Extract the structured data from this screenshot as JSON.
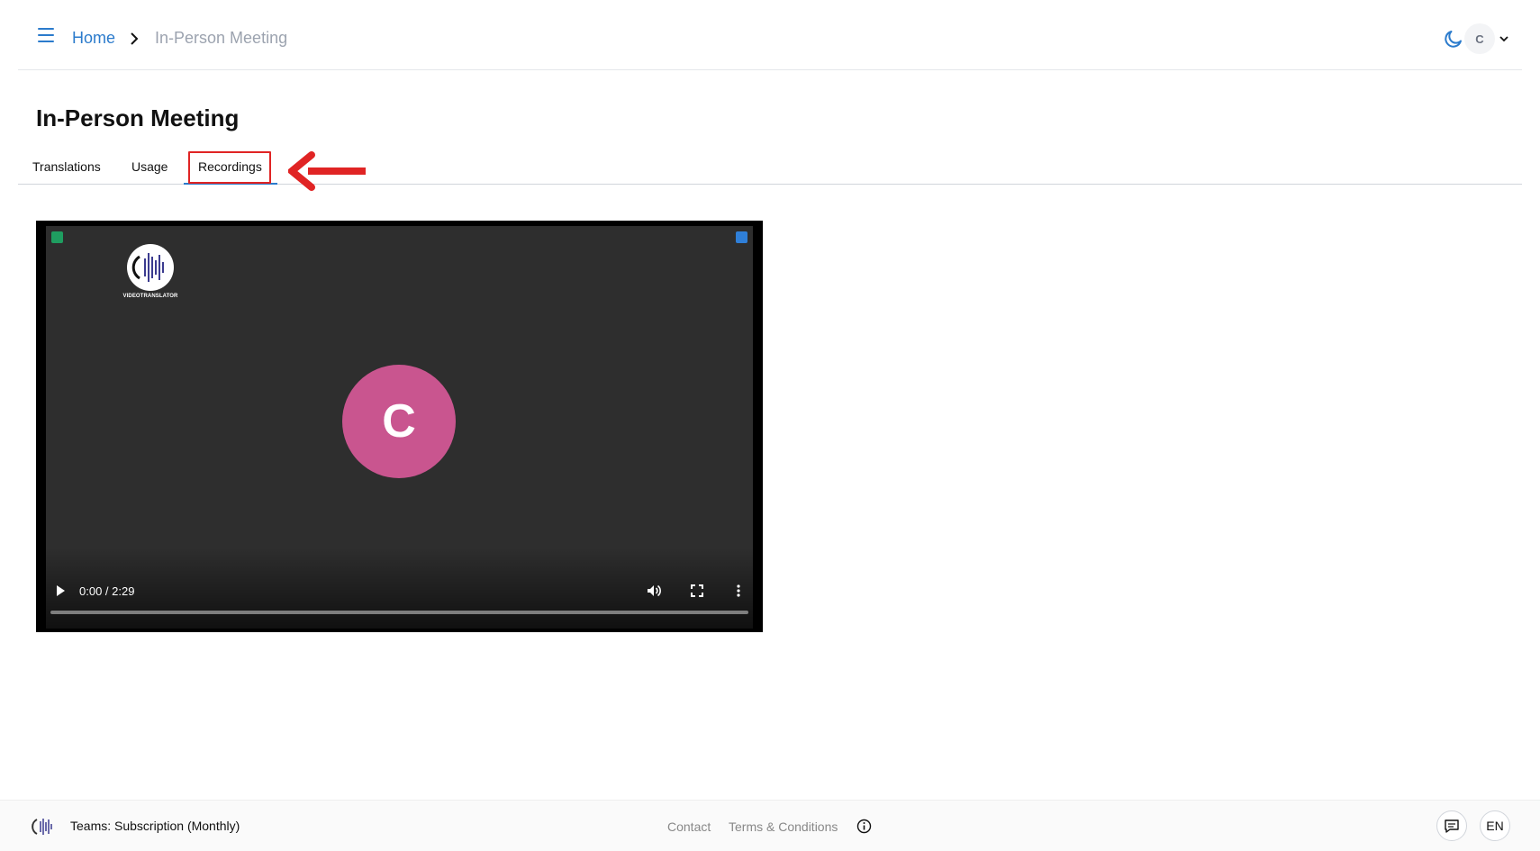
{
  "header": {
    "breadcrumb": {
      "home": "Home",
      "current": "In-Person Meeting"
    },
    "user_initial": "C",
    "icons": [
      "menu-icon",
      "chevron-right-icon",
      "moon-icon",
      "chevron-down-icon"
    ],
    "accent_color": "#2b7bcc"
  },
  "page": {
    "title": "In-Person Meeting",
    "tabs": [
      {
        "label": "Translations",
        "selected": false
      },
      {
        "label": "Usage",
        "selected": false
      },
      {
        "label": "Recordings",
        "selected": true
      }
    ],
    "annotation_color": "#e02424"
  },
  "video": {
    "logo_text": "VIDEOTRANSLATOR",
    "participant_initial": "C",
    "participant_color": "#c9558f",
    "time_display": "0:00 / 2:29",
    "current_time": "0:00",
    "duration": "2:29",
    "progress_fraction": 0.0,
    "icons": [
      "play-icon",
      "volume-icon",
      "fullscreen-icon",
      "more-vertical-icon"
    ]
  },
  "footer": {
    "subscription": "Teams: Subscription (Monthly)",
    "contact": "Contact",
    "terms": "Terms & Conditions",
    "language": "EN",
    "icons": [
      "info-icon",
      "chat-icon"
    ]
  }
}
